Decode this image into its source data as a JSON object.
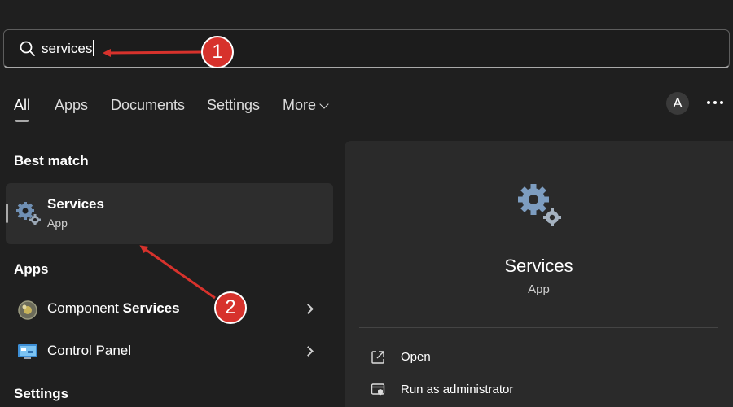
{
  "search": {
    "query": "services"
  },
  "tabs": [
    {
      "label": "All",
      "active": true
    },
    {
      "label": "Apps"
    },
    {
      "label": "Documents"
    },
    {
      "label": "Settings"
    },
    {
      "label": "More"
    }
  ],
  "header": {
    "avatar_initial": "A",
    "more_icon": "ellipsis-icon"
  },
  "best_match": {
    "heading": "Best match",
    "title": "Services",
    "subtitle": "App",
    "icon": "gears-icon"
  },
  "apps": {
    "heading": "Apps",
    "items": [
      {
        "label_prefix": "Component ",
        "label_bold": "Services",
        "icon": "component-services-icon"
      },
      {
        "label_prefix": "Control Panel",
        "label_bold": "",
        "icon": "control-panel-icon"
      }
    ]
  },
  "settings": {
    "heading": "Settings"
  },
  "detail": {
    "title": "Services",
    "subtitle": "App",
    "actions": [
      {
        "label": "Open",
        "icon": "open-external-icon"
      },
      {
        "label": "Run as administrator",
        "icon": "shield-admin-icon"
      }
    ]
  },
  "annotations": [
    {
      "number": "1",
      "color": "#d7322c"
    },
    {
      "number": "2",
      "color": "#d7322c"
    }
  ]
}
